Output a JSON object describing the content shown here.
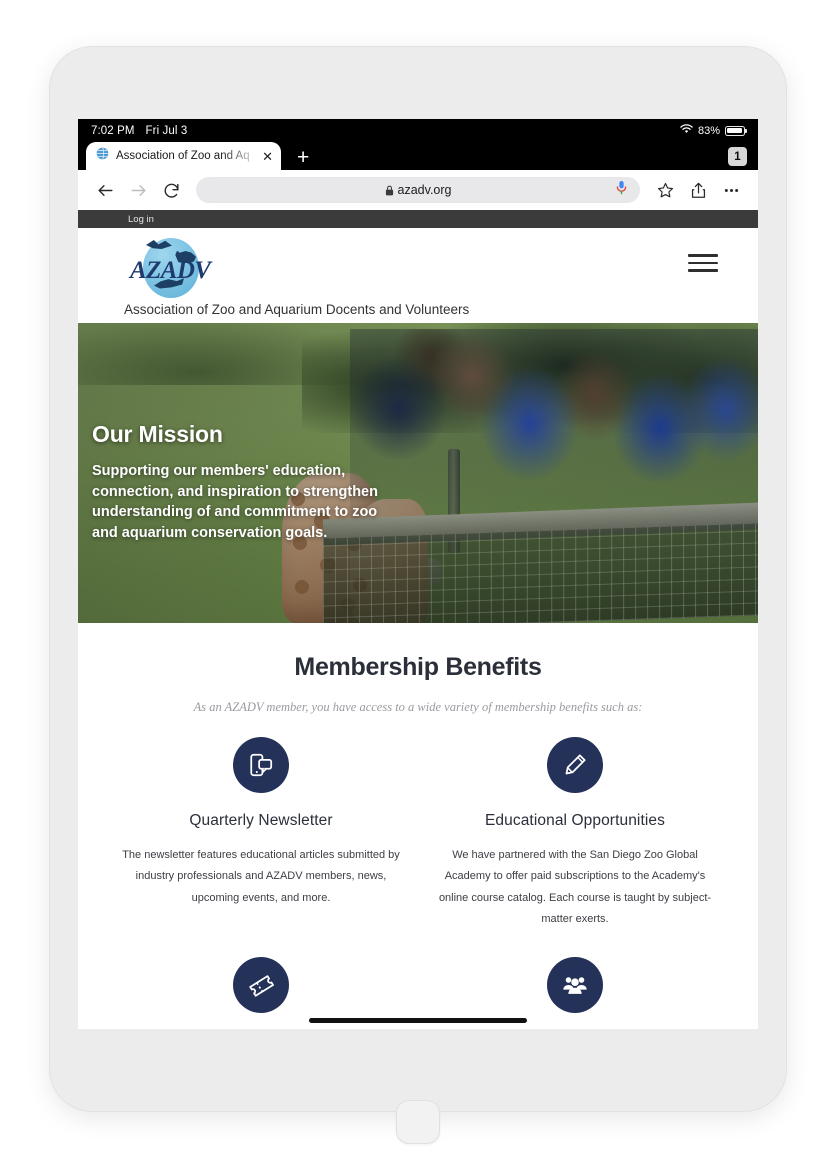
{
  "status_bar": {
    "time": "7:02 PM",
    "date": "Fri Jul 3",
    "battery_percent": "83%",
    "wifi_icon": "wifi-icon",
    "battery_icon": "battery-icon"
  },
  "browser": {
    "tab": {
      "title": "Association of Zoo and Aq",
      "favicon": "globe-favicon",
      "close_icon": "close-icon"
    },
    "new_tab_icon": "plus-icon",
    "tab_count": "1",
    "toolbar": {
      "back_icon": "back-arrow-icon",
      "forward_icon": "forward-arrow-icon",
      "reload_icon": "reload-icon",
      "lock_icon": "lock-icon",
      "url": "azadv.org",
      "mic_icon": "microphone-icon",
      "bookmark_icon": "star-icon",
      "share_icon": "share-icon",
      "menu_icon": "more-options-icon"
    }
  },
  "site": {
    "utility_bar": {
      "login_label": "Log in"
    },
    "header": {
      "logo_text": "AZADV",
      "org_name": "Association of Zoo and Aquarium Docents and Volunteers",
      "menu_icon": "hamburger-menu-icon"
    },
    "hero": {
      "title": "Our Mission",
      "body": "Supporting our members' education, connection, and inspiration to strengthen understanding of and commitment to zoo and aquarium conservation goals.",
      "image_alt": "giraffes-and-zoo-visitors-photo"
    },
    "benefits": {
      "heading": "Membership Benefits",
      "subheading": "As an AZADV member, you have access to a wide variety of membership benefits such as:",
      "accent_color": "#243159",
      "cards": [
        {
          "icon": "mobile-chat-icon",
          "title": "Quarterly Newsletter",
          "text": "The newsletter features educational articles submitted by industry professionals and AZADV members, news, upcoming events, and more."
        },
        {
          "icon": "pencil-icon",
          "title": "Educational Opportunities",
          "text": "We have partnered with the San Diego Zoo Global Academy to offer paid subscriptions to the Academy's online course catalog. Each course is taught by subject-matter exerts."
        },
        {
          "icon": "ticket-icon",
          "title": "",
          "text": ""
        },
        {
          "icon": "people-group-icon",
          "title": "",
          "text": ""
        }
      ]
    }
  },
  "device": {
    "home_button": "home-button",
    "home_indicator": "home-indicator"
  }
}
